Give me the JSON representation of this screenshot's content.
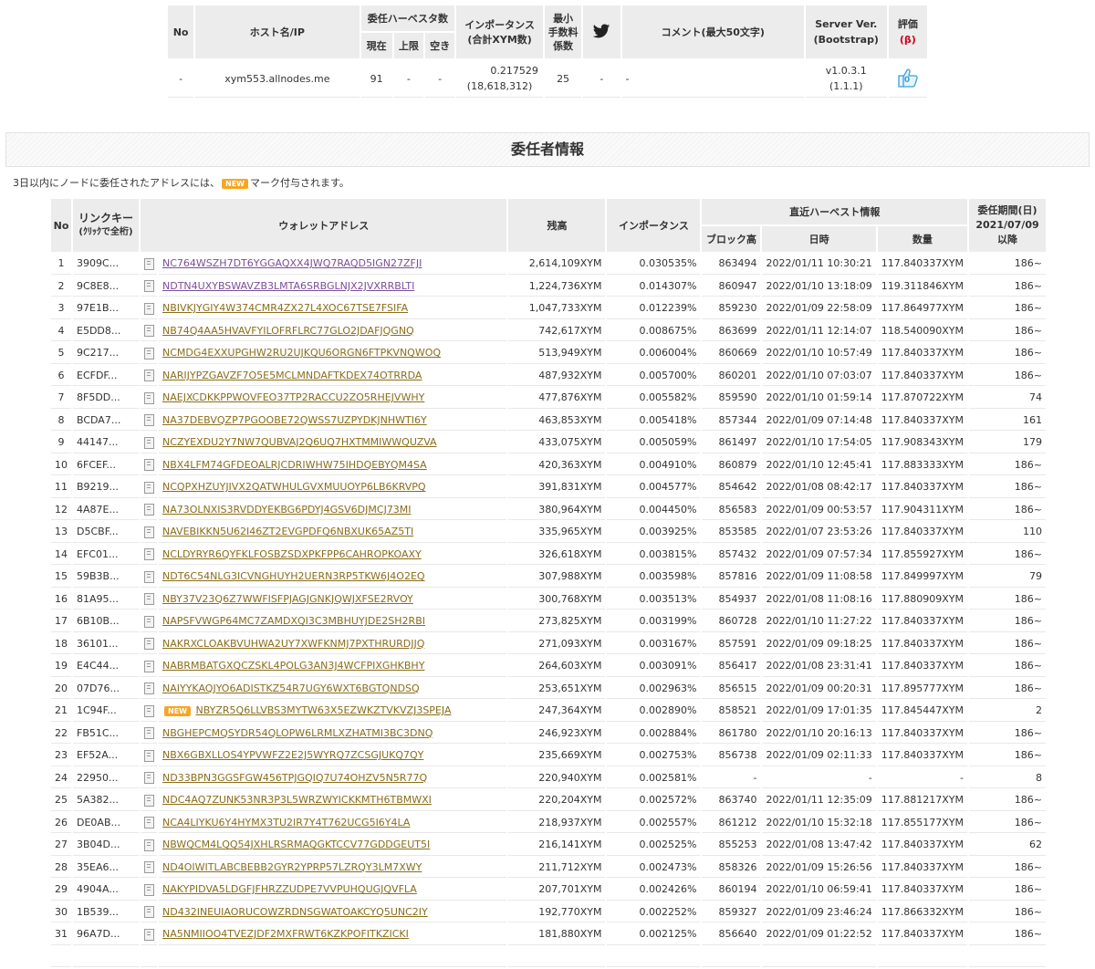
{
  "node_table": {
    "headers": {
      "no": "No",
      "host": "ホスト名/IP",
      "harvesters": "委任ハーベスタ数",
      "current": "現在",
      "max": "上限",
      "free": "空き",
      "importance_line1": "インポータンス",
      "importance_line2": "(合計XYM数)",
      "fee_line1": "最小",
      "fee_line2": "手数料",
      "fee_line3": "係数",
      "comment": "コメント(最大50文字)",
      "server_line1": "Server Ver.",
      "server_line2": "(Bootstrap)",
      "rating": "評価",
      "rating_beta": "(β)"
    },
    "row": {
      "no": "-",
      "host": "xym553.allnodes.me",
      "current": "91",
      "max": "-",
      "free": "-",
      "importance": "0.217529",
      "total_xym": "(18,618,312)",
      "min_fee": "25",
      "twitter": "-",
      "comment": "-",
      "server_ver": "v1.0.3.1",
      "bootstrap": "(1.1.1)",
      "like_count": "0"
    }
  },
  "section_title": "委任者情報",
  "notice": {
    "before": "3日以内にノードに委任されたアドレスには、",
    "badge": "NEW",
    "after": "マーク付与されます。"
  },
  "delegator_table": {
    "headers": {
      "no": "No",
      "link_key": "リンクキー",
      "link_key_sub": "(ｸﾘｯｸで全桁)",
      "address": "ウォレットアドレス",
      "balance": "残高",
      "importance": "インポータンス",
      "recent_harvest": "直近ハーベスト情報",
      "block_height": "ブロック高",
      "datetime": "日時",
      "amount": "数量",
      "period_line1": "委任期間(日)",
      "period_line2": "2021/07/09",
      "period_line3": "以降"
    },
    "rows": [
      {
        "no": "1",
        "key": "3909C...",
        "address": "NC764WSZH7DT6YGGAQXX4JWQ7RAQD5IGN27ZFJI",
        "balance": "2,614,109XYM",
        "importance": "0.030535%",
        "height": "863494",
        "datetime": "2022/01/11 10:30:21",
        "amount": "117.840337XYM",
        "days": "186~",
        "new": false,
        "visited": true
      },
      {
        "no": "2",
        "key": "9C8E8...",
        "address": "NDTN4UXYBSWAVZB3LMTA6SRBGLNJX2JVXRRBLTI",
        "balance": "1,224,736XYM",
        "importance": "0.014307%",
        "height": "860947",
        "datetime": "2022/01/10 13:18:09",
        "amount": "119.311846XYM",
        "days": "186~",
        "new": false,
        "visited": true
      },
      {
        "no": "3",
        "key": "97E1B...",
        "address": "NBIVKJYGIY4W374CMR4ZX27L4XOC67TSE7FSIFA",
        "balance": "1,047,733XYM",
        "importance": "0.012239%",
        "height": "859230",
        "datetime": "2022/01/09 22:58:09",
        "amount": "117.864977XYM",
        "days": "186~",
        "new": false,
        "visited": false
      },
      {
        "no": "4",
        "key": "E5DD8...",
        "address": "NB74Q4AA5HVAVFYILOFRFLRC77GLO2JDAFJQGNQ",
        "balance": "742,617XYM",
        "importance": "0.008675%",
        "height": "863699",
        "datetime": "2022/01/11 12:14:07",
        "amount": "118.540090XYM",
        "days": "186~",
        "new": false,
        "visited": false
      },
      {
        "no": "5",
        "key": "9C217...",
        "address": "NCMDG4EXXUPGHW2RU2UJKQU6ORGN6FTPKVNQWOQ",
        "balance": "513,949XYM",
        "importance": "0.006004%",
        "height": "860669",
        "datetime": "2022/01/10 10:57:49",
        "amount": "117.840337XYM",
        "days": "186~",
        "new": false,
        "visited": false
      },
      {
        "no": "6",
        "key": "ECFDF...",
        "address": "NARIJYPZGAVZF7O5E5MCLMNDAFTKDEX74OTRRDA",
        "balance": "487,932XYM",
        "importance": "0.005700%",
        "height": "860201",
        "datetime": "2022/01/10 07:03:07",
        "amount": "117.840337XYM",
        "days": "186~",
        "new": false,
        "visited": false
      },
      {
        "no": "7",
        "key": "8F5DD...",
        "address": "NAEJXCDKKPPWOVFEO37TP2RACCU2ZO5RHEJVWHY",
        "balance": "477,876XYM",
        "importance": "0.005582%",
        "height": "859590",
        "datetime": "2022/01/10 01:59:14",
        "amount": "117.870722XYM",
        "days": "74",
        "new": false,
        "visited": false
      },
      {
        "no": "8",
        "key": "BCDA7...",
        "address": "NA37DEBVQZP7PGOOBE72QWSS7UZPYDKJNHWTI6Y",
        "balance": "463,853XYM",
        "importance": "0.005418%",
        "height": "857344",
        "datetime": "2022/01/09 07:14:48",
        "amount": "117.840337XYM",
        "days": "161",
        "new": false,
        "visited": false
      },
      {
        "no": "9",
        "key": "44147...",
        "address": "NCZYEXDU2Y7NW7QUBVAJ2Q6UQ7HXTMMIWWQUZVA",
        "balance": "433,075XYM",
        "importance": "0.005059%",
        "height": "861497",
        "datetime": "2022/01/10 17:54:05",
        "amount": "117.908343XYM",
        "days": "179",
        "new": false,
        "visited": false
      },
      {
        "no": "10",
        "key": "6FCEF...",
        "address": "NBX4LFM74GFDEOALRJCDRIWHW75IHDQEBYQM4SA",
        "balance": "420,363XYM",
        "importance": "0.004910%",
        "height": "860879",
        "datetime": "2022/01/10 12:45:41",
        "amount": "117.883333XYM",
        "days": "186~",
        "new": false,
        "visited": false
      },
      {
        "no": "11",
        "key": "B9219...",
        "address": "NCQPXHZUYJIVX2QATWHULGVXMUUOYP6LB6KRVPQ",
        "balance": "391,831XYM",
        "importance": "0.004577%",
        "height": "854642",
        "datetime": "2022/01/08 08:42:17",
        "amount": "117.840337XYM",
        "days": "186~",
        "new": false,
        "visited": false
      },
      {
        "no": "12",
        "key": "4A87E...",
        "address": "NA73OLNXIS3RVDDYEKBG6PDYJ4GSV6DJMCJ73MI",
        "balance": "380,964XYM",
        "importance": "0.004450%",
        "height": "856583",
        "datetime": "2022/01/09 00:53:57",
        "amount": "117.904311XYM",
        "days": "186~",
        "new": false,
        "visited": false
      },
      {
        "no": "13",
        "key": "D5CBF...",
        "address": "NAVEBIKKN5U62I46ZT2EVGPDFQ6NBXUK65AZ5TI",
        "balance": "335,965XYM",
        "importance": "0.003925%",
        "height": "853585",
        "datetime": "2022/01/07 23:53:26",
        "amount": "117.840337XYM",
        "days": "110",
        "new": false,
        "visited": false
      },
      {
        "no": "14",
        "key": "EFC01...",
        "address": "NCLDYRYR6QYFKLFOSBZSDXPKFPP6CAHROPKOAXY",
        "balance": "326,618XYM",
        "importance": "0.003815%",
        "height": "857432",
        "datetime": "2022/01/09 07:57:34",
        "amount": "117.855927XYM",
        "days": "186~",
        "new": false,
        "visited": false
      },
      {
        "no": "15",
        "key": "59B3B...",
        "address": "NDT6C54NLG3ICVNGHUYH2UERN3RP5TKW6J4O2EQ",
        "balance": "307,988XYM",
        "importance": "0.003598%",
        "height": "857816",
        "datetime": "2022/01/09 11:08:58",
        "amount": "117.849997XYM",
        "days": "79",
        "new": false,
        "visited": false
      },
      {
        "no": "16",
        "key": "81A95...",
        "address": "NBY37V23Q6Z7WWFISFPJAGJGNKJQWJXFSE2RVOY",
        "balance": "300,768XYM",
        "importance": "0.003513%",
        "height": "854937",
        "datetime": "2022/01/08 11:08:16",
        "amount": "117.880909XYM",
        "days": "186~",
        "new": false,
        "visited": false
      },
      {
        "no": "17",
        "key": "6B10B...",
        "address": "NAPSFVWGP64MC7ZAMDXQI3C3MBHUYJDE2SH2RBI",
        "balance": "273,825XYM",
        "importance": "0.003199%",
        "height": "860728",
        "datetime": "2022/01/10 11:27:22",
        "amount": "117.840337XYM",
        "days": "186~",
        "new": false,
        "visited": false
      },
      {
        "no": "18",
        "key": "36101...",
        "address": "NAKRXCLOAKBVUHWA2UY7XWFKNMJ7PXTHRURDJJQ",
        "balance": "271,093XYM",
        "importance": "0.003167%",
        "height": "857591",
        "datetime": "2022/01/09 09:18:25",
        "amount": "117.840337XYM",
        "days": "186~",
        "new": false,
        "visited": false
      },
      {
        "no": "19",
        "key": "E4C44...",
        "address": "NABRMBATGXQCZSKL4POLG3AN3J4WCFPIXGHKBHY",
        "balance": "264,603XYM",
        "importance": "0.003091%",
        "height": "856417",
        "datetime": "2022/01/08 23:31:41",
        "amount": "117.840337XYM",
        "days": "186~",
        "new": false,
        "visited": false
      },
      {
        "no": "20",
        "key": "07D76...",
        "address": "NAIYYKAQJYO6ADISTKZ54R7UGY6WXT6BGTQNDSQ",
        "balance": "253,651XYM",
        "importance": "0.002963%",
        "height": "856515",
        "datetime": "2022/01/09 00:20:31",
        "amount": "117.895777XYM",
        "days": "186~",
        "new": false,
        "visited": false
      },
      {
        "no": "21",
        "key": "1C94F...",
        "address": "NBYZR5Q6LLVBS3MYTW63X5EZWKZTVKVZJ3SPEJA",
        "balance": "247,364XYM",
        "importance": "0.002890%",
        "height": "858521",
        "datetime": "2022/01/09 17:01:35",
        "amount": "117.845447XYM",
        "days": "2",
        "new": true,
        "visited": false
      },
      {
        "no": "22",
        "key": "FB51C...",
        "address": "NBGHEPCMQSYDR54QLOPW6LRMLXZHATMI3BC3DNQ",
        "balance": "246,923XYM",
        "importance": "0.002884%",
        "height": "861780",
        "datetime": "2022/01/10 20:16:13",
        "amount": "117.840337XYM",
        "days": "186~",
        "new": false,
        "visited": false
      },
      {
        "no": "23",
        "key": "EF52A...",
        "address": "NBX6GBXLLOS4YPVWFZ2E2J5WYRQ7ZCSGJUKQ7QY",
        "balance": "235,669XYM",
        "importance": "0.002753%",
        "height": "856738",
        "datetime": "2022/01/09 02:11:33",
        "amount": "117.840337XYM",
        "days": "186~",
        "new": false,
        "visited": false
      },
      {
        "no": "24",
        "key": "22950...",
        "address": "ND33BPN3GGSFGW456TPJGQIQ7U74OHZV5N5R77Q",
        "balance": "220,940XYM",
        "importance": "0.002581%",
        "height": "-",
        "datetime": "-",
        "amount": "-",
        "days": "8",
        "new": false,
        "visited": false
      },
      {
        "no": "25",
        "key": "5A382...",
        "address": "NDC4AQ7ZUNK53NR3P3L5WRZWYICKKMTH6TBMWXI",
        "balance": "220,204XYM",
        "importance": "0.002572%",
        "height": "863740",
        "datetime": "2022/01/11 12:35:09",
        "amount": "117.881217XYM",
        "days": "186~",
        "new": false,
        "visited": false
      },
      {
        "no": "26",
        "key": "DE0AB...",
        "address": "NCA4LIYKU6Y4HYMX3TU2IR7Y4T762UCG5I6Y4LA",
        "balance": "218,937XYM",
        "importance": "0.002557%",
        "height": "861212",
        "datetime": "2022/01/10 15:32:18",
        "amount": "117.855177XYM",
        "days": "186~",
        "new": false,
        "visited": false
      },
      {
        "no": "27",
        "key": "3B04D...",
        "address": "NBWQCM4LQQ54JXHLRSRMAQGKTCCV77GDDGEUT5I",
        "balance": "216,141XYM",
        "importance": "0.002525%",
        "height": "855253",
        "datetime": "2022/01/08 13:47:42",
        "amount": "117.840337XYM",
        "days": "62",
        "new": false,
        "visited": false
      },
      {
        "no": "28",
        "key": "35EA6...",
        "address": "ND4OIWITLABCBEBB2GYR2YPRP57LZRQY3LM7XWY",
        "balance": "211,712XYM",
        "importance": "0.002473%",
        "height": "858326",
        "datetime": "2022/01/09 15:26:56",
        "amount": "117.840337XYM",
        "days": "186~",
        "new": false,
        "visited": false
      },
      {
        "no": "29",
        "key": "4904A...",
        "address": "NAKYPIDVA5LDGFJFHRZZUDPE7VVPUHQUGJQVFLA",
        "balance": "207,701XYM",
        "importance": "0.002426%",
        "height": "860194",
        "datetime": "2022/01/10 06:59:41",
        "amount": "117.840337XYM",
        "days": "186~",
        "new": false,
        "visited": false
      },
      {
        "no": "30",
        "key": "1B539...",
        "address": "ND432INEUIAORUCOWZRDNSGWATOAKCYQ5UNC2IY",
        "balance": "192,770XYM",
        "importance": "0.002252%",
        "height": "859327",
        "datetime": "2022/01/09 23:46:24",
        "amount": "117.866332XYM",
        "days": "186~",
        "new": false,
        "visited": false
      },
      {
        "no": "31",
        "key": "96A7D...",
        "address": "NA5NMIIOO4TVEZJDF2MXFRWT6KZKPOFITKZICKI",
        "balance": "181,880XYM",
        "importance": "0.002125%",
        "height": "856640",
        "datetime": "2022/01/09 01:22:52",
        "amount": "117.840337XYM",
        "days": "186~",
        "new": false,
        "visited": false
      }
    ]
  },
  "colors": {
    "link": "#8a6d1b",
    "link_visited": "#7b4d9a",
    "header_bg": "#ececec",
    "new_badge": "#f6a623",
    "like_blue": "#3aa0d8",
    "beta_red": "#d0021b"
  }
}
